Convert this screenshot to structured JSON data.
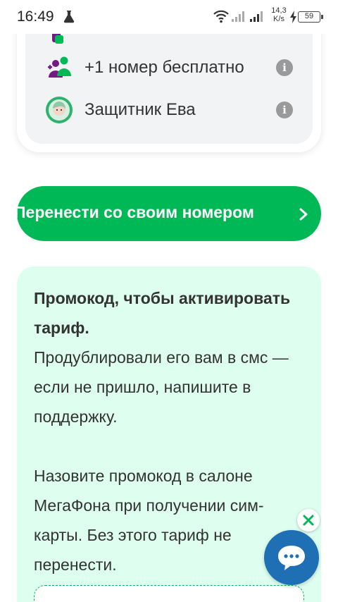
{
  "status_bar": {
    "time": "16:49",
    "net_speed_value": "14,3",
    "net_speed_unit": "K/s",
    "battery": "59"
  },
  "options": [
    {
      "label": "+1 номер бесплатно",
      "icon": "people-icon",
      "info_icon": "info-icon"
    },
    {
      "label": "Защитник Ева",
      "icon": "eva-avatar-icon",
      "info_icon": "info-icon"
    }
  ],
  "transfer_button": {
    "label": "Перенести со своим номером",
    "icon": "chevron-right-icon"
  },
  "promo": {
    "title": "Промокод, чтобы активировать тариф.",
    "body1": "Продублировали его вам в смс — если не пришло, напишите в поддержку.",
    "body2": "Назовите промокод в салоне МегаФона при получении сим-карты. Без этого тариф не перенести."
  },
  "floating": {
    "chat_icon": "chat-bubble-icon",
    "close_icon": "close-icon"
  },
  "colors": {
    "brand_green": "#00b956",
    "promo_bg": "#defff0",
    "chat_blue": "#1e6fb4",
    "option_bg": "#f2f3f5",
    "purple": "#731982"
  }
}
